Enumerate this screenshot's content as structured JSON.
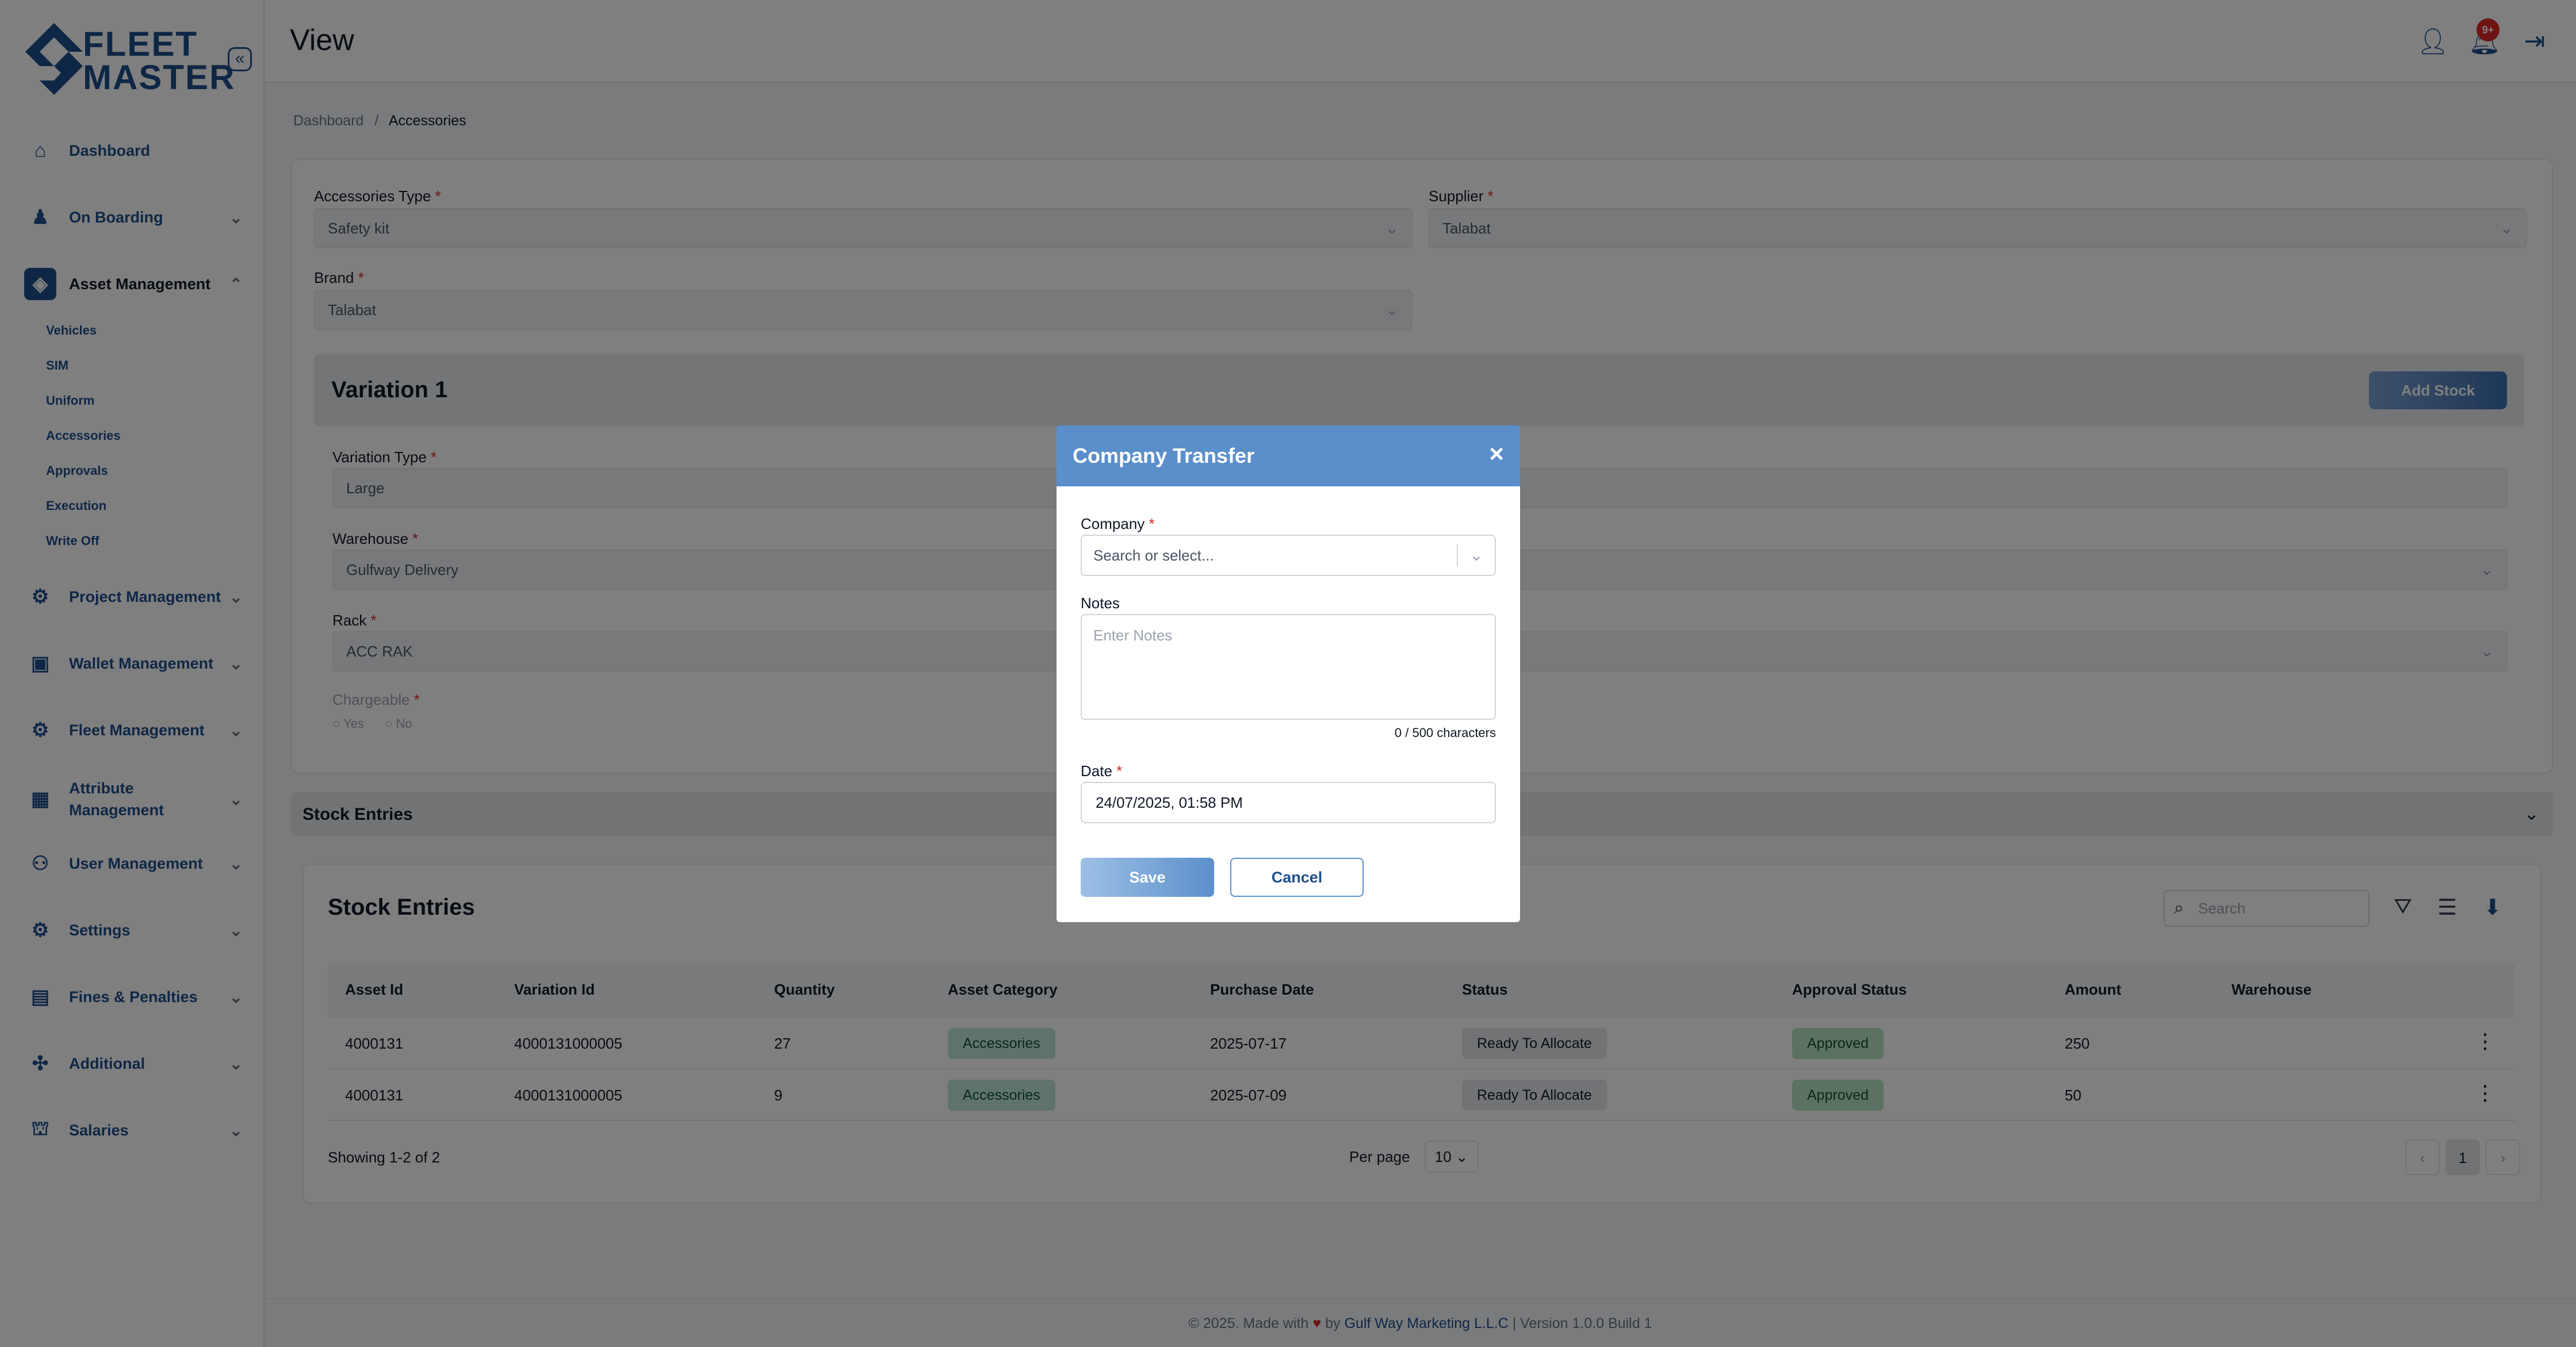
{
  "app": {
    "logo_line1": "FLEET",
    "logo_line2": "MASTER",
    "collapse_glyph": "«"
  },
  "header": {
    "title": "View",
    "notif_badge": "9+",
    "icons": [
      "user-icon",
      "bell-icon",
      "logout-icon"
    ]
  },
  "sidebar": {
    "items": [
      {
        "label": "Dashboard",
        "icon": "home-icon"
      },
      {
        "label": "On Boarding",
        "icon": "onboarding-icon"
      },
      {
        "label": "Asset Management",
        "icon": "asset-icon"
      },
      {
        "label": "Project Management",
        "icon": "project-icon"
      },
      {
        "label": "Wallet Management",
        "icon": "wallet-icon"
      },
      {
        "label": "Fleet Management",
        "icon": "fleet-icon"
      },
      {
        "label": "Attribute Management",
        "icon": "attribute-icon"
      },
      {
        "label": "User Management",
        "icon": "users-icon"
      },
      {
        "label": "Settings",
        "icon": "gear-icon"
      },
      {
        "label": "Fines & Penalties",
        "icon": "fines-icon"
      },
      {
        "label": "Additional",
        "icon": "additional-icon"
      },
      {
        "label": "Salaries",
        "icon": "salary-icon"
      }
    ],
    "sub_items": [
      "Vehicles",
      "SIM",
      "Uniform",
      "Accessories",
      "Approvals",
      "Execution",
      "Write Off"
    ]
  },
  "breadcrumb": {
    "root": "Dashboard",
    "separator": "/",
    "current": "Accessories"
  },
  "form": {
    "accessories_type_label": "Accessories Type",
    "accessories_type_value": "Safety kit",
    "supplier_label": "Supplier",
    "supplier_value": "Talabat",
    "brand_label": "Brand",
    "brand_value": "Talabat",
    "required_mark": "*"
  },
  "variation": {
    "title": "Variation 1",
    "add_stock_label": "Add Stock",
    "type_label": "Variation Type",
    "type_value": "Large",
    "warehouse_label": "Warehouse",
    "warehouse_value": "Gulfway Delivery",
    "rack_label": "Rack",
    "rack_value": "ACC RAK",
    "chargeable_label": "Chargeable",
    "yes_label": "Yes",
    "no_label": "No"
  },
  "stock_section": {
    "title": "Stock Entries"
  },
  "stock_table": {
    "title": "Stock Entries",
    "search_placeholder": "Search",
    "columns": [
      "Asset Id",
      "Variation Id",
      "Quantity",
      "Asset Category",
      "Purchase Date",
      "Status",
      "Approval Status",
      "Amount",
      "Warehouse"
    ],
    "rows": [
      {
        "asset_id": "4000131",
        "variation_id": "4000131000005",
        "quantity": "27",
        "category": "Accessories",
        "purchase_date": "2025-07-17",
        "status": "Ready To Allocate",
        "approval": "Approved",
        "amount": "250",
        "warehouse": ""
      },
      {
        "asset_id": "4000131",
        "variation_id": "4000131000005",
        "quantity": "9",
        "category": "Accessories",
        "purchase_date": "2025-07-09",
        "status": "Ready To Allocate",
        "approval": "Approved",
        "amount": "50",
        "warehouse": ""
      }
    ],
    "showing": "Showing 1-2 of 2",
    "per_page_label": "Per page",
    "per_page_value": "10",
    "page": "1"
  },
  "modal": {
    "title": "Company Transfer",
    "company_label": "Company",
    "company_placeholder": "Search or select...",
    "notes_label": "Notes",
    "notes_placeholder": "Enter Notes",
    "notes_counter": "0 / 500 characters",
    "date_label": "Date",
    "date_value": "24/07/2025, 01:58 PM",
    "save_label": "Save",
    "cancel_label": "Cancel"
  },
  "footer": {
    "prefix": "© 2025. Made with",
    "by": "by",
    "company": "Gulf Way Marketing L.L.C",
    "version": "| Version 1.0.0 Build 1"
  },
  "colors": {
    "brand": "#1e4e8c",
    "modal_header": "#5b8fcb",
    "overlay": "rgba(0,0,0,0.5)"
  }
}
